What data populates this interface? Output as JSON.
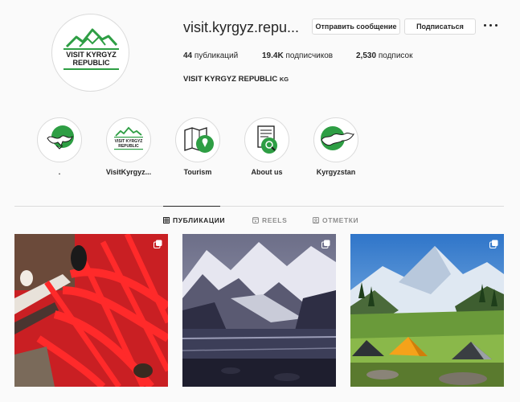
{
  "profile": {
    "username": "visit.kyrgyz.repu...",
    "logo_line1": "VISIT KYRGYZ",
    "logo_line2": "REPUBLIC",
    "fullname": "VISIT KYRGYZ REPUBLIC",
    "country_code": "KG"
  },
  "buttons": {
    "message": "Отправить сообщение",
    "follow": "Подписаться"
  },
  "stats": {
    "posts_count": "44",
    "posts_label": "публикаций",
    "followers_count": "19.4K",
    "followers_label": "подписчиков",
    "following_count": "2,530",
    "following_label": "подписок"
  },
  "highlights": [
    {
      "label": "."
    },
    {
      "label": "VisitKyrgyz..."
    },
    {
      "label": "Tourism"
    },
    {
      "label": "About us"
    },
    {
      "label": "Kyrgyzstan"
    }
  ],
  "tabs": {
    "posts": "ПУБЛИКАЦИИ",
    "reels": "REELS",
    "tagged": "ОТМЕТКИ"
  },
  "colors": {
    "brand_green": "#2e9e44",
    "text": "#262626",
    "muted": "#8e8e8e",
    "border": "#dbdbdb"
  }
}
